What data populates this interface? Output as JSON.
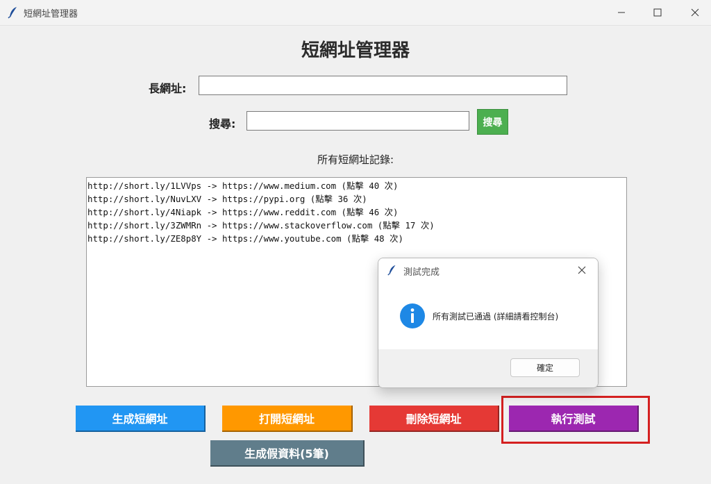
{
  "window": {
    "title": "短網址管理器",
    "app_icon": "feather-icon",
    "controls": [
      "minimize-icon",
      "maximize-icon",
      "close-icon"
    ]
  },
  "main": {
    "heading": "短網址管理器",
    "long_url": {
      "label": "長網址:",
      "value": "",
      "placeholder": ""
    },
    "search": {
      "label": "搜尋:",
      "value": "",
      "placeholder": "",
      "button_label": "搜尋",
      "button_color": "#4caf50"
    },
    "list_label": "所有短網址記錄:",
    "records": [
      "http://short.ly/1LVVps -> https://www.medium.com (點擊 40 次)",
      "http://short.ly/NuvLXV -> https://pypi.org (點擊 36 次)",
      "http://short.ly/4Niapk -> https://www.reddit.com (點擊 46 次)",
      "http://short.ly/3ZWMRn -> https://www.stackoverflow.com (點擊 17 次)",
      "http://short.ly/ZE8p8Y -> https://www.youtube.com (點擊 48 次)"
    ]
  },
  "actions": {
    "generate": {
      "label": "生成短網址",
      "color": "#2196f3"
    },
    "open": {
      "label": "打開短網址",
      "color": "#ff9800"
    },
    "delete": {
      "label": "刪除短網址",
      "color": "#e53935"
    },
    "run_tests": {
      "label": "執行測試",
      "color": "#9c27b0"
    },
    "fake_data": {
      "label": "生成假資料(5筆)",
      "color": "#607d8b"
    }
  },
  "highlight_color": "#d42020",
  "dialog": {
    "title": "測試完成",
    "icon": "info-icon",
    "message": "所有測試已通過 (詳細請看控制台)",
    "ok_label": "確定"
  }
}
